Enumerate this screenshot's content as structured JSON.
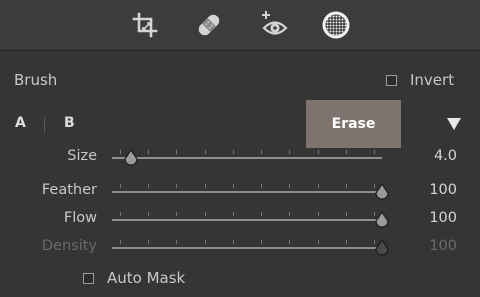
{
  "toolstrip": {
    "tools": [
      {
        "name": "crop",
        "icon": "crop-icon"
      },
      {
        "name": "healing",
        "icon": "bandage-icon"
      },
      {
        "name": "red-eye",
        "icon": "eye-plus-icon"
      },
      {
        "name": "masking",
        "icon": "dotted-circle-icon"
      }
    ]
  },
  "brush": {
    "label": "Brush",
    "invert_label": "Invert",
    "invert_checked": false,
    "tab_a": "A",
    "tab_b": "B",
    "erase_label": "Erase"
  },
  "sliders": [
    {
      "label": "Size",
      "value": "4.0",
      "fraction": 0.07,
      "enabled": true
    },
    {
      "label": "Feather",
      "value": "100",
      "fraction": 1.0,
      "enabled": true
    },
    {
      "label": "Flow",
      "value": "100",
      "fraction": 1.0,
      "enabled": true
    },
    {
      "label": "Density",
      "value": "100",
      "fraction": 1.0,
      "enabled": false
    }
  ],
  "auto_mask": {
    "label": "Auto Mask",
    "checked": false
  },
  "colors": {
    "panel_bg": "#353535",
    "toolstrip_bg": "#3c3c3c",
    "erase_button": "#7f7370",
    "text": "#c8c8c8",
    "disabled_text": "#6a6a6a"
  }
}
